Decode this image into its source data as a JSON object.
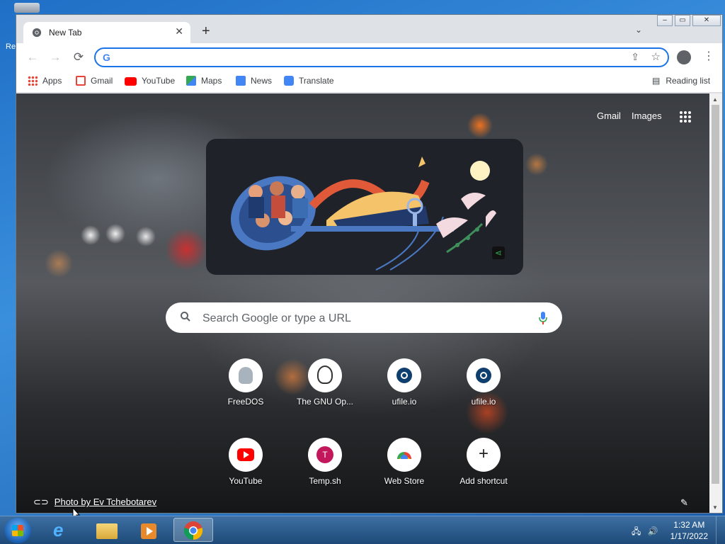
{
  "browser": {
    "tab": {
      "title": "New Tab"
    },
    "omnibox": {
      "value": "",
      "placeholder": ""
    },
    "bookmarks": [
      {
        "label": "Apps",
        "icon": "apps-grid-icon"
      },
      {
        "label": "Gmail",
        "icon": "gmail-icon"
      },
      {
        "label": "YouTube",
        "icon": "youtube-icon"
      },
      {
        "label": "Maps",
        "icon": "maps-icon"
      },
      {
        "label": "News",
        "icon": "news-icon"
      },
      {
        "label": "Translate",
        "icon": "translate-icon"
      }
    ],
    "reading_list": "Reading list"
  },
  "ntp": {
    "top_links": {
      "gmail": "Gmail",
      "images": "Images"
    },
    "search": {
      "placeholder": "Search Google or type a URL"
    },
    "shortcuts": [
      {
        "label": "FreeDOS"
      },
      {
        "label": "The GNU Op..."
      },
      {
        "label": "ufile.io"
      },
      {
        "label": "ufile.io"
      },
      {
        "label": "YouTube"
      },
      {
        "label": "Temp.sh",
        "letter": "T"
      },
      {
        "label": "Web Store"
      },
      {
        "label": "Add shortcut"
      }
    ],
    "photo_credit": "Photo by Ev Tchebotarev"
  },
  "taskbar": {
    "time": "1:32 AM",
    "date": "1/17/2022"
  },
  "colors": {
    "accent": "#1a73e8",
    "youtube_red": "#ff0000",
    "ufile_blue": "#0f3f6e",
    "temp_pink": "#c2185b"
  }
}
